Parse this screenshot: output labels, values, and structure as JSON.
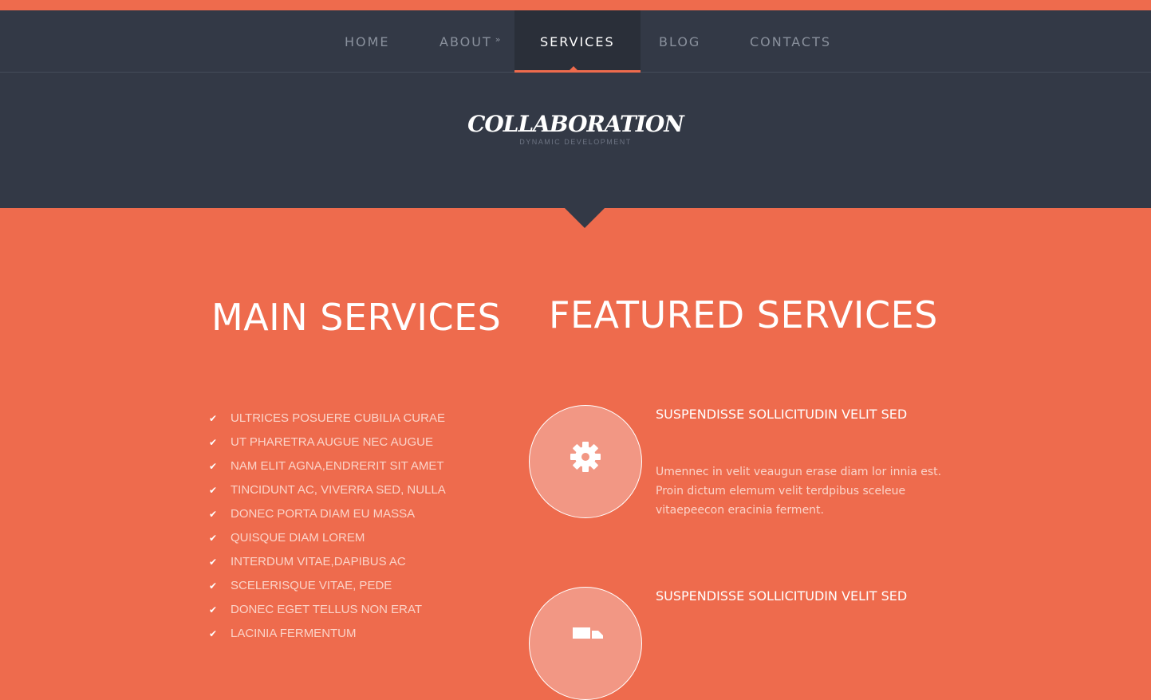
{
  "nav": {
    "items": [
      {
        "label": "HOME"
      },
      {
        "label": "ABOUT",
        "suffix": "»"
      },
      {
        "label": "SERVICES",
        "active": true
      },
      {
        "label": "BLOG"
      },
      {
        "label": "CONTACTS"
      }
    ]
  },
  "hero": {
    "logo": "COLLABORATION",
    "tagline": "DYNAMIC DEVELOPMENT"
  },
  "main_services": {
    "heading": "MAIN SERVICES",
    "items": [
      "ULTRICES POSUERE CUBILIA CURAE",
      "UT PHARETRA AUGUE NEC AUGUE",
      "NAM ELIT AGNA,ENDRERIT SIT AMET",
      "TINCIDUNT AC, VIVERRA SED, NULLA",
      "DONEC PORTA DIAM EU MASSA",
      "QUISQUE DIAM LOREM",
      "INTERDUM VITAE,DAPIBUS AC",
      "SCELERISQUE VITAE, PEDE",
      "DONEC EGET TELLUS NON ERAT",
      "LACINIA FERMENTUM"
    ]
  },
  "featured_services": {
    "heading": "FEATURED SERVICES",
    "items": [
      {
        "title": "SUSPENDISSE SOLLICITUDIN VELIT SED",
        "text": "Umennec in velit veaugun erase diam lor innia est. Proin dictum elemum velit terdpibus sceleue vitaepeecon eracinia ferment.",
        "icon": "gear-icon"
      },
      {
        "title": "SUSPENDISSE SOLLICITUDIN VELIT SED",
        "icon": "truck-icon"
      }
    ]
  },
  "colors": {
    "accent": "#ee6b4d",
    "dark": "#333946",
    "circle": "#f29784",
    "muted_text": "#fbd3c8"
  }
}
